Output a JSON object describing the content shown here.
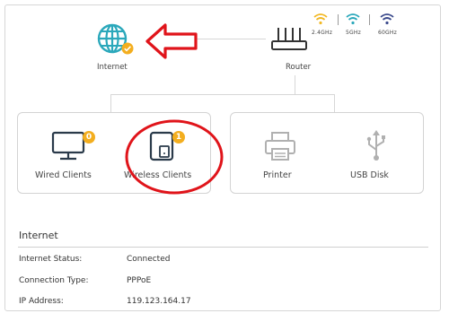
{
  "topology": {
    "internet_label": "Internet",
    "router_label": "Router",
    "bands": [
      "2.4GHz",
      "5GHz",
      "60GHz"
    ]
  },
  "clients": {
    "wired_label": "Wired Clients",
    "wired_count": "0",
    "wireless_label": "Wireless Clients",
    "wireless_count": "1",
    "printer_label": "Printer",
    "usb_label": "USB Disk"
  },
  "internet_section": {
    "title": "Internet",
    "rows": [
      {
        "key": "Internet Status:",
        "value": "Connected"
      },
      {
        "key": "Connection Type:",
        "value": "PPPoE"
      },
      {
        "key": "IP Address:",
        "value": "119.123.164.17"
      }
    ]
  },
  "colors": {
    "accent": "#2ba8bb",
    "badge": "#f3ae1f",
    "annotation_red": "#e0141a",
    "wifi_24": "#f2b824",
    "wifi_5": "#2ba8bb",
    "wifi_60": "#3b4a8c"
  },
  "icons": [
    "globe-icon",
    "check-icon",
    "router-icon",
    "wifi-icon",
    "monitor-icon",
    "tablet-icon",
    "printer-icon",
    "usb-icon",
    "arrow-annotation"
  ]
}
